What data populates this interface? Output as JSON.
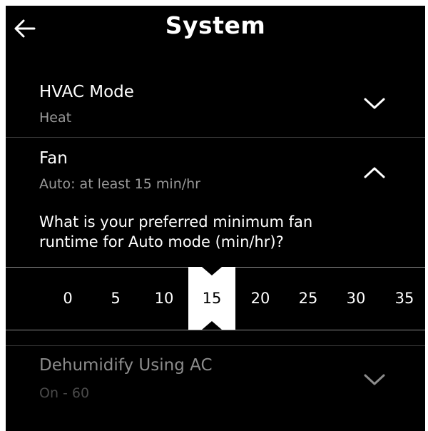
{
  "header": {
    "title": "System",
    "back_icon": "arrow-left-icon"
  },
  "settings": [
    {
      "title": "HVAC Mode",
      "value": "Heat",
      "state": "collapsed",
      "icon": "chevron-down-icon"
    },
    {
      "title": "Fan",
      "value": "Auto: at least 15 min/hr",
      "state": "expanded",
      "icon": "chevron-up-icon"
    },
    {
      "title": "Dehumidify Using AC",
      "value": "On - 60",
      "state": "collapsed-disabled",
      "icon": "chevron-down-icon"
    }
  ],
  "fan_panel": {
    "question": "What is your preferred minimum fan runtime for Auto mode (min/hr)?",
    "options": [
      "0",
      "5",
      "10",
      "15",
      "20",
      "25",
      "30",
      "35"
    ],
    "selected": "15"
  },
  "colors": {
    "background": "#000000",
    "text": "#ffffff",
    "secondary_text": "#9a9a9a",
    "disabled_text": "#8c8c8c",
    "divider": "#3a3a3a"
  }
}
